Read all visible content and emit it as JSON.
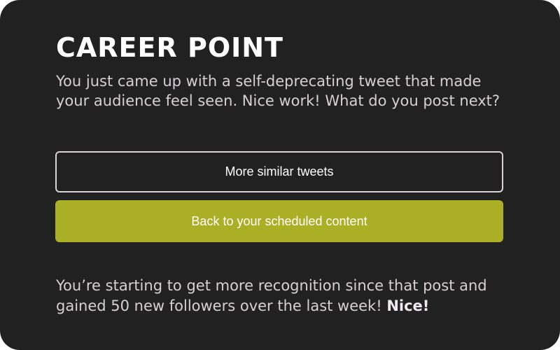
{
  "card": {
    "title": "CAREER POINT",
    "prompt": "You just came up with a self-deprecating tweet that made your audience feel seen. Nice work! What do you post next?"
  },
  "choices": [
    {
      "label": "More similar tweets"
    },
    {
      "label": "Back to your scheduled content"
    }
  ],
  "outcome": {
    "text": "You’re starting to get more recognition since that post and gained 50 new followers over the last week! ",
    "emphasis": "Nice!"
  },
  "colors": {
    "background": "#212121",
    "accent": "#abaf26",
    "text": "#d6d0d4",
    "title": "#ffffff"
  }
}
